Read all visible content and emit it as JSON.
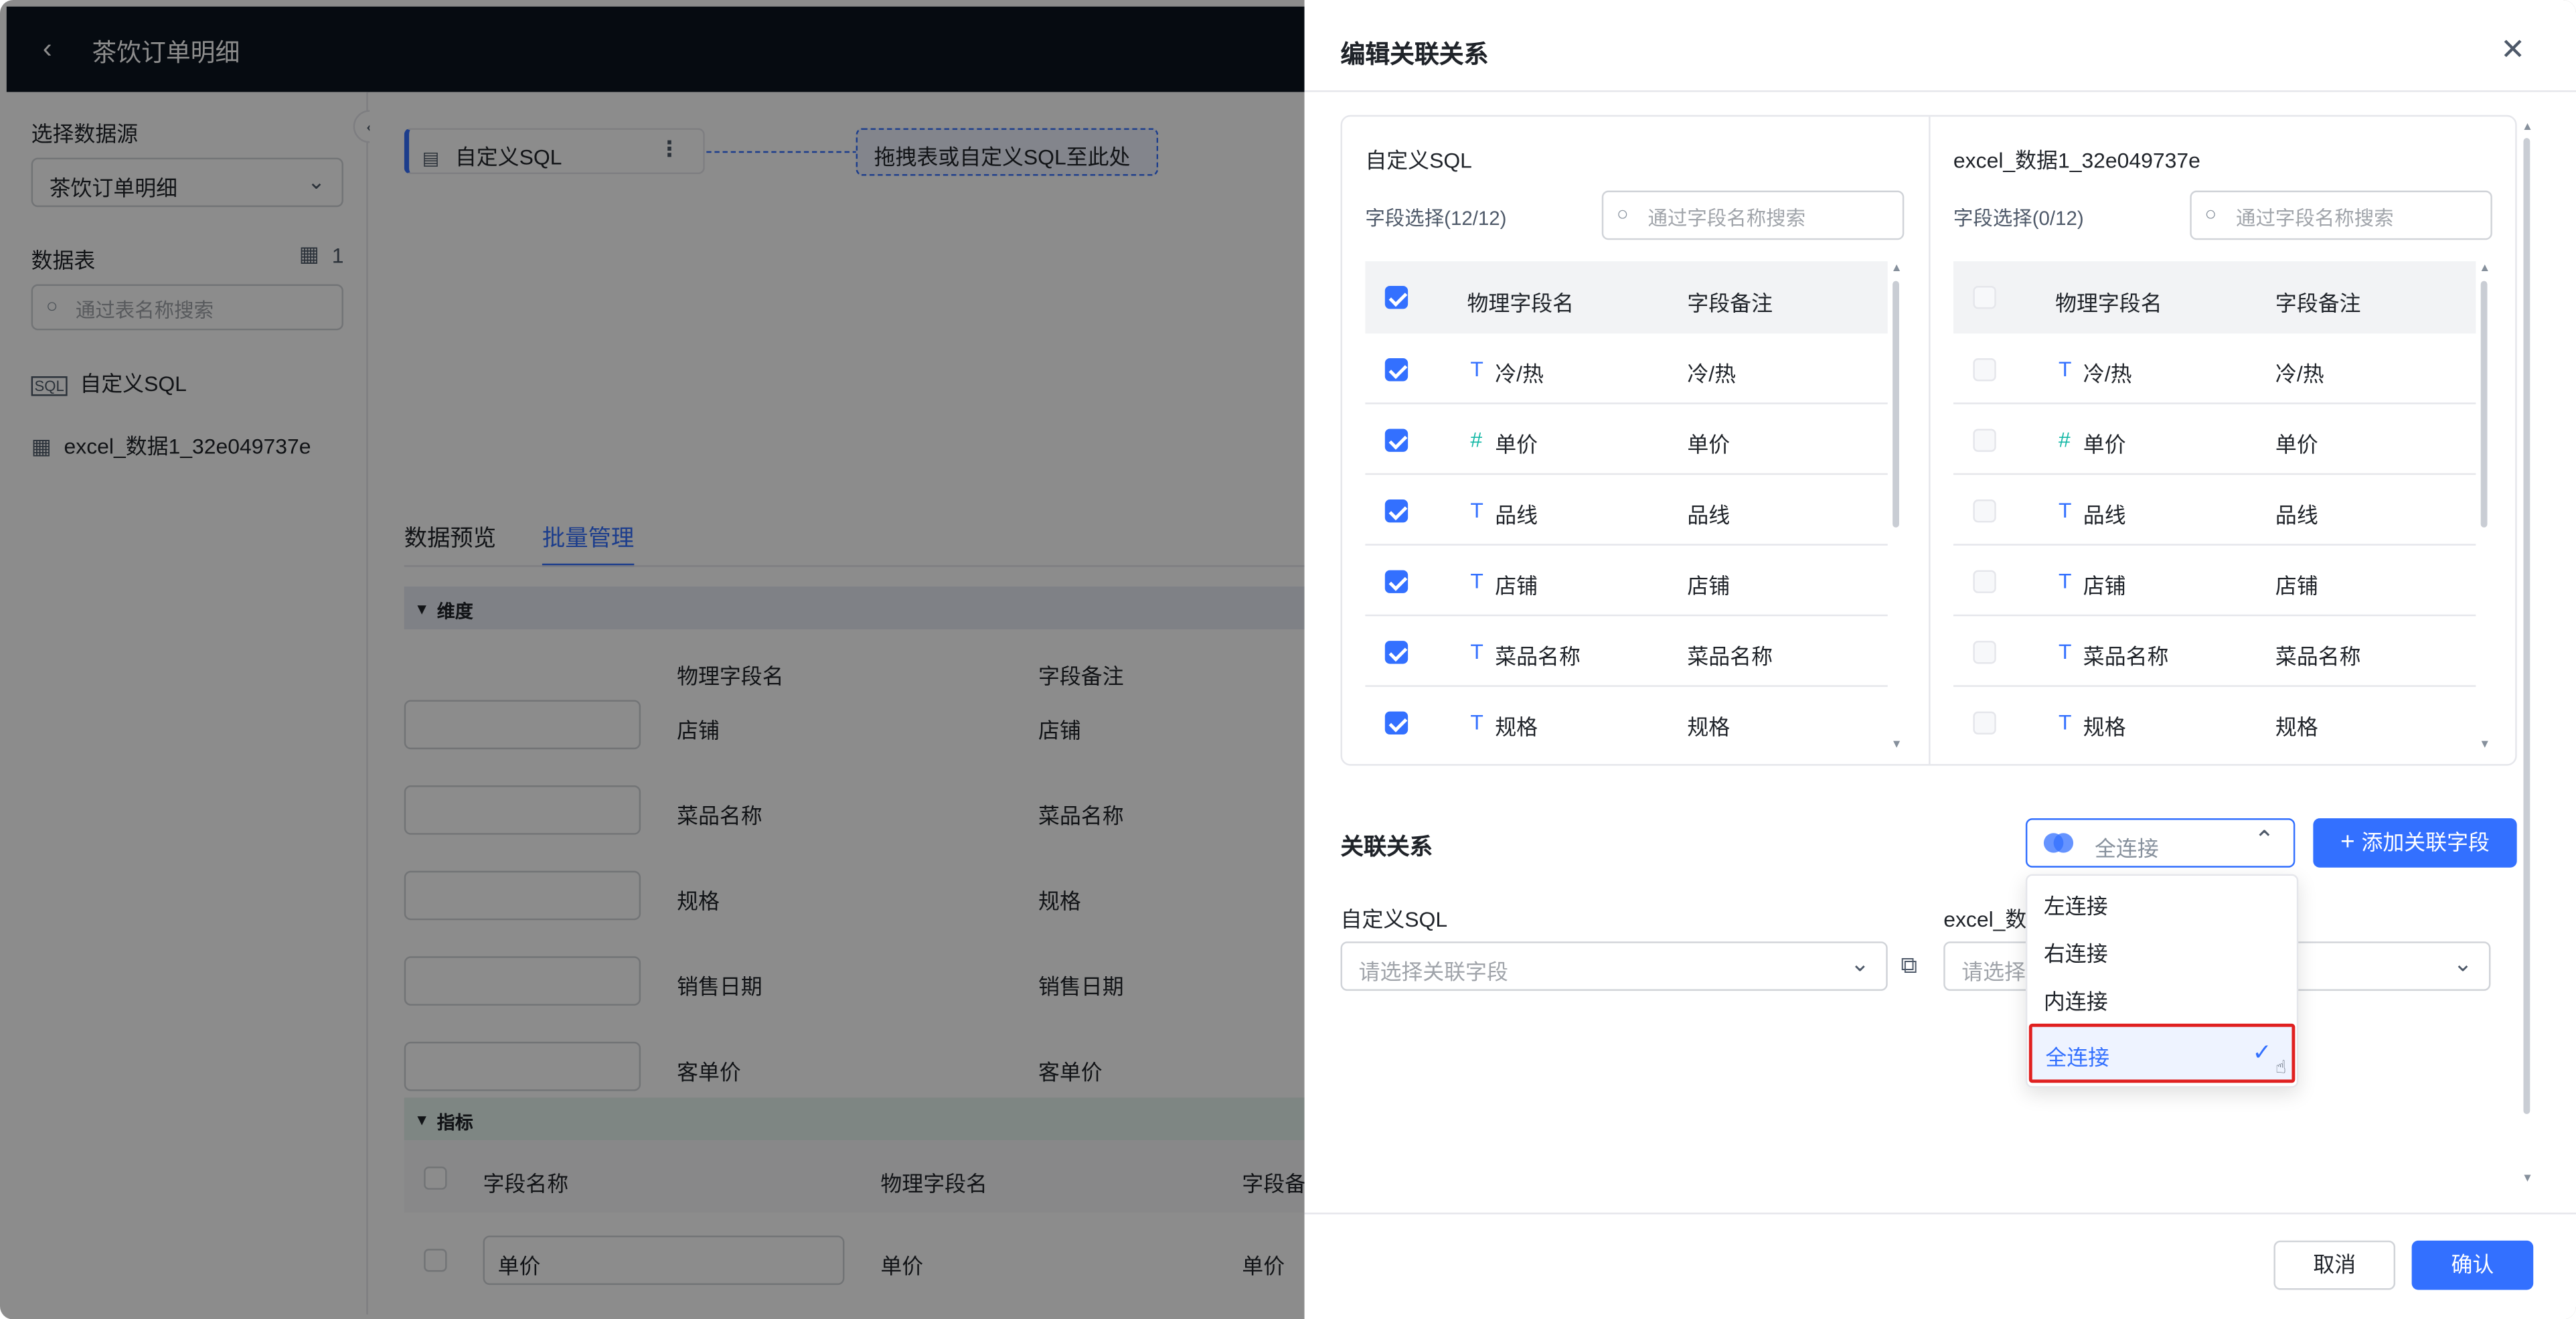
{
  "page": {
    "title": "茶饮订单明细",
    "back_icon": "chevron-left-icon"
  },
  "sidebar": {
    "datasource_label": "选择数据源",
    "datasource_value": "茶饮订单明细",
    "tables_label": "数据表",
    "tables_count": "1",
    "table_search_placeholder": "通过表名称搜索",
    "items": [
      {
        "label": "自定义SQL",
        "icon": "sql-icon"
      },
      {
        "label": "excel_数据1_32e049737e",
        "icon": "table-icon"
      }
    ]
  },
  "canvas": {
    "node_label": "自定义SQL",
    "drop_hint": "拖拽表或自定义SQL至此处"
  },
  "tabs": [
    {
      "label": "数据预览",
      "active": false
    },
    {
      "label": "批量管理",
      "active": true
    }
  ],
  "dimensions": {
    "group_label": "维度",
    "headers": [
      "物理字段名",
      "字段备注"
    ],
    "rows": [
      {
        "physical": "店铺",
        "remark": "店铺"
      },
      {
        "physical": "菜品名称",
        "remark": "菜品名称"
      },
      {
        "physical": "规格",
        "remark": "规格"
      },
      {
        "physical": "销售日期",
        "remark": "销售日期"
      },
      {
        "physical": "客单价",
        "remark": "客单价"
      }
    ]
  },
  "metrics": {
    "group_label": "指标",
    "headers": [
      "字段名称",
      "物理字段名",
      "字段备"
    ],
    "rows": [
      {
        "name": "单价",
        "physical": "单价",
        "remark": "单价"
      }
    ]
  },
  "drawer": {
    "title": "编辑关联关系",
    "left_table": {
      "title": "自定义SQL",
      "count_label": "字段选择(12/12)",
      "search_placeholder": "通过字段名称搜索",
      "headers": [
        "物理字段名",
        "字段备注"
      ],
      "rows": [
        {
          "type": "T",
          "name": "冷/热",
          "remark": "冷/热",
          "checked": true
        },
        {
          "type": "#",
          "name": "单价",
          "remark": "单价",
          "checked": true
        },
        {
          "type": "T",
          "name": "品线",
          "remark": "品线",
          "checked": true
        },
        {
          "type": "T",
          "name": "店铺",
          "remark": "店铺",
          "checked": true
        },
        {
          "type": "T",
          "name": "菜品名称",
          "remark": "菜品名称",
          "checked": true
        },
        {
          "type": "T",
          "name": "规格",
          "remark": "规格",
          "checked": true
        }
      ]
    },
    "right_table": {
      "title": "excel_数据1_32e049737e",
      "count_label": "字段选择(0/12)",
      "search_placeholder": "通过字段名称搜索",
      "headers": [
        "物理字段名",
        "字段备注"
      ],
      "rows": [
        {
          "type": "T",
          "name": "冷/热",
          "remark": "冷/热",
          "checked": false
        },
        {
          "type": "#",
          "name": "单价",
          "remark": "单价",
          "checked": false
        },
        {
          "type": "T",
          "name": "品线",
          "remark": "品线",
          "checked": false
        },
        {
          "type": "T",
          "name": "店铺",
          "remark": "店铺",
          "checked": false
        },
        {
          "type": "T",
          "name": "菜品名称",
          "remark": "菜品名称",
          "checked": false
        },
        {
          "type": "T",
          "name": "规格",
          "remark": "规格",
          "checked": false
        }
      ]
    },
    "relation": {
      "label": "关联关系",
      "join_value": "全连接",
      "add_button": "添加关联字段",
      "left_label": "自定义SQL",
      "right_label": "excel_数",
      "left_placeholder": "请选择关联字段",
      "right_placeholder": "请选择"
    },
    "join_options": [
      {
        "label": "左连接",
        "selected": false
      },
      {
        "label": "右连接",
        "selected": false
      },
      {
        "label": "内连接",
        "selected": false
      },
      {
        "label": "全连接",
        "selected": true
      }
    ],
    "cancel_button": "取消",
    "confirm_button": "确认"
  },
  "colors": {
    "accent": "#3370ff",
    "highlight_border": "#e02020",
    "topbar": "#0b1420"
  }
}
